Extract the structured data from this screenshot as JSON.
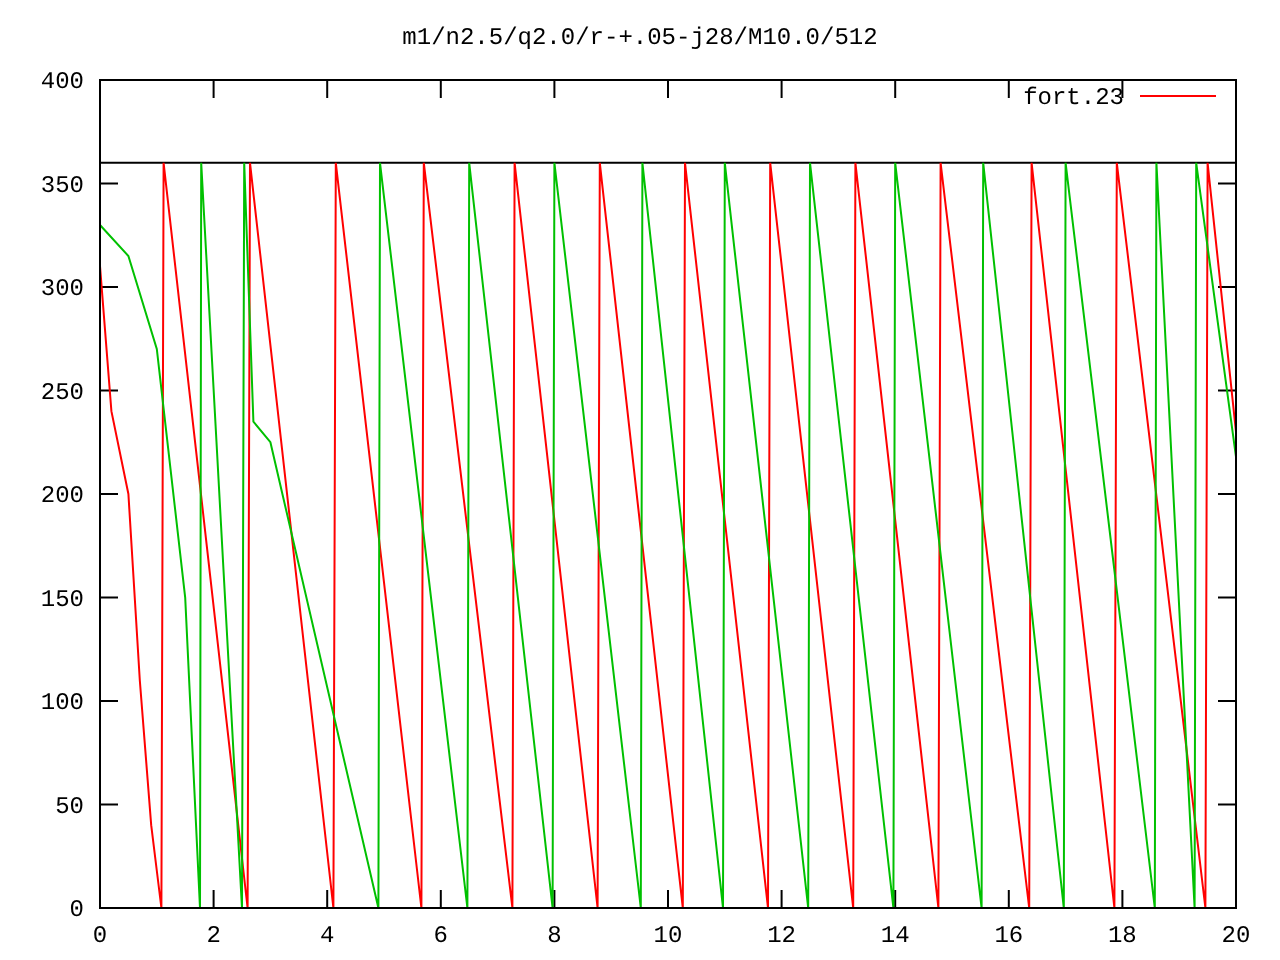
{
  "chart": {
    "chart_data": {
      "type": "line",
      "title": "m1/n2.5/q2.0/r-+.05-j28/M10.0/512",
      "xlim": [
        0,
        20
      ],
      "ylim": [
        0,
        400
      ],
      "xticks": [
        0,
        2,
        4,
        6,
        8,
        10,
        12,
        14,
        16,
        18,
        20
      ],
      "yticks": [
        0,
        50,
        100,
        150,
        200,
        250,
        300,
        350,
        400
      ],
      "ref_lines": [
        {
          "axis": "y",
          "value": 360
        }
      ],
      "series": [
        {
          "name": "fort.23",
          "color": "#ff0000",
          "x": [
            0,
            0.2,
            0.5,
            0.7,
            0.9,
            1.08,
            1.12,
            2.6,
            2.64,
            4.11,
            4.15,
            5.66,
            5.7,
            7.26,
            7.3,
            8.76,
            8.8,
            10.26,
            10.3,
            11.76,
            11.8,
            13.26,
            13.3,
            14.76,
            14.8,
            16.36,
            16.4,
            17.86,
            17.9,
            19.46,
            19.5,
            20
          ],
          "values": [
            310,
            240,
            200,
            110,
            40,
            0,
            360,
            0,
            360,
            0,
            360,
            0,
            360,
            0,
            360,
            0,
            360,
            0,
            360,
            0,
            360,
            0,
            360,
            0,
            360,
            0,
            360,
            0,
            360,
            0,
            360,
            230
          ]
        },
        {
          "color": "#00c000",
          "x": [
            0,
            0.5,
            1.0,
            1.5,
            1.76,
            1.78,
            2.5,
            2.54,
            2.7,
            3.0,
            4.9,
            4.93,
            6.47,
            6.5,
            7.97,
            8.0,
            9.52,
            9.55,
            10.97,
            11.0,
            12.47,
            12.5,
            13.97,
            14.0,
            15.52,
            15.55,
            16.97,
            17.0,
            18.57,
            18.6,
            19.27,
            19.3,
            20
          ],
          "values": [
            330,
            315,
            270,
            150,
            0,
            360,
            0,
            360,
            235,
            225,
            0,
            360,
            0,
            360,
            0,
            360,
            0,
            360,
            0,
            360,
            0,
            360,
            0,
            360,
            0,
            360,
            0,
            360,
            0,
            360,
            0,
            360,
            218
          ]
        }
      ]
    }
  }
}
